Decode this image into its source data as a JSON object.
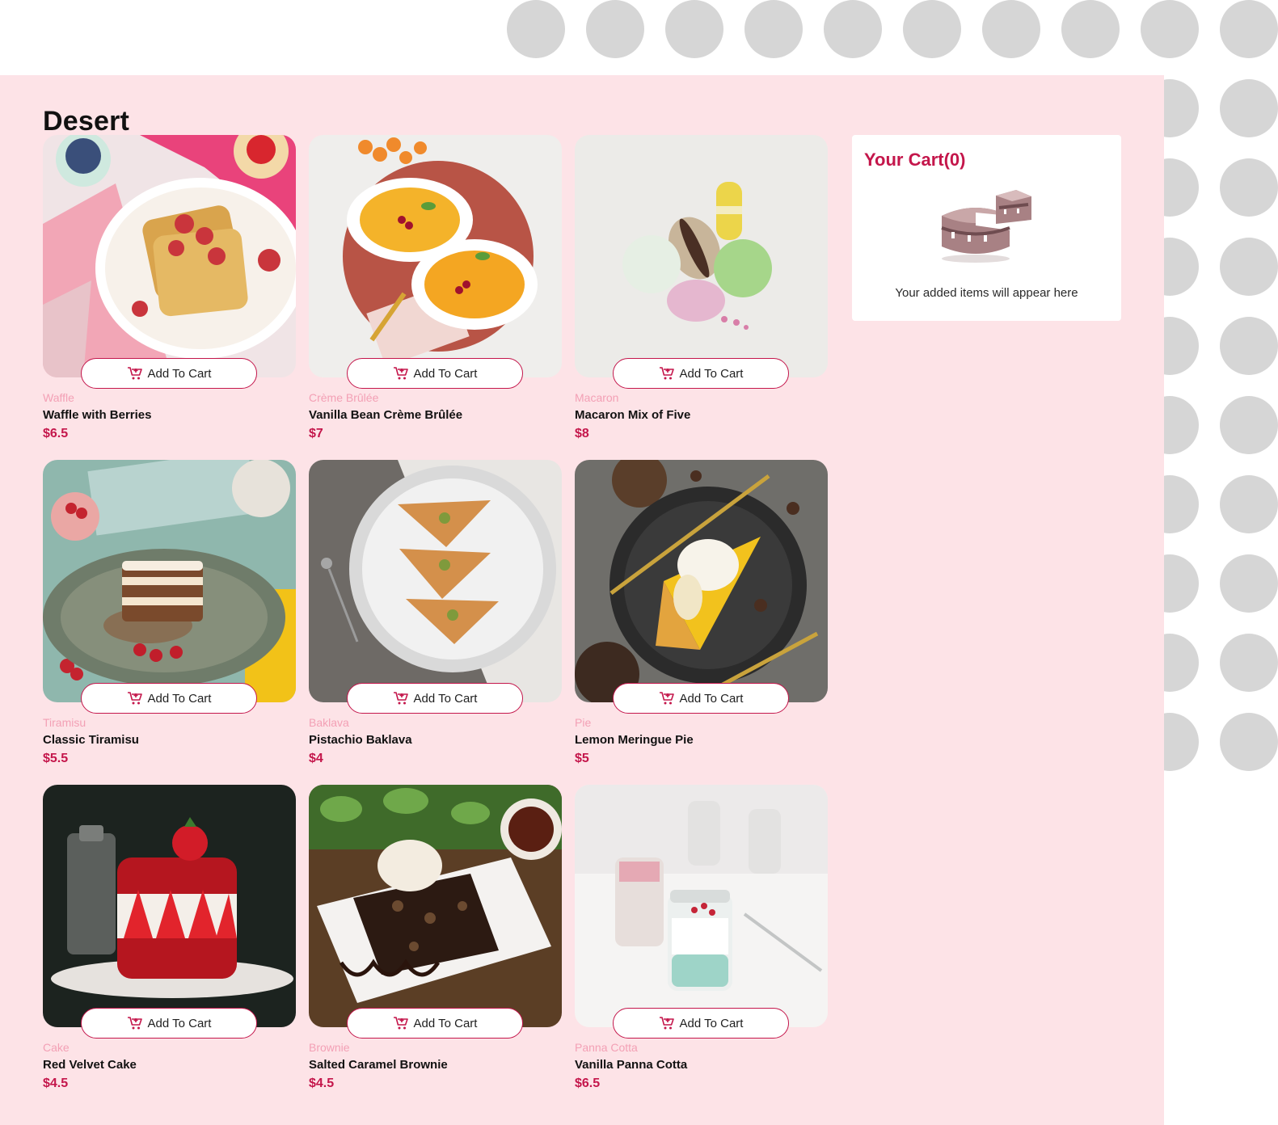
{
  "section": {
    "title": "Desert"
  },
  "products": [
    {
      "category": "Waffle",
      "name": "Waffle with Berries",
      "price": "$6.5",
      "button_label": "Add To Cart",
      "image": "waffle-image"
    },
    {
      "category": "Crème Brûlée",
      "name": "Vanilla Bean Crème Brûlée",
      "price": "$7",
      "button_label": "Add To Cart",
      "image": "creme-brulee-image"
    },
    {
      "category": "Macaron",
      "name": "Macaron Mix of Five",
      "price": "$8",
      "button_label": "Add To Cart",
      "image": "macaron-image"
    },
    {
      "category": "Tiramisu",
      "name": "Classic Tiramisu",
      "price": "$5.5",
      "button_label": "Add To Cart",
      "image": "tiramisu-image"
    },
    {
      "category": "Baklava",
      "name": "Pistachio Baklava",
      "price": "$4",
      "button_label": "Add To Cart",
      "image": "baklava-image"
    },
    {
      "category": "Pie",
      "name": "Lemon Meringue Pie",
      "price": "$5",
      "button_label": "Add To Cart",
      "image": "pie-image"
    },
    {
      "category": "Cake",
      "name": "Red Velvet Cake",
      "price": "$4.5",
      "button_label": "Add To Cart",
      "image": "cake-image"
    },
    {
      "category": "Brownie",
      "name": "Salted Caramel Brownie",
      "price": "$4.5",
      "button_label": "Add To Cart",
      "image": "brownie-image"
    },
    {
      "category": "Panna Cotta",
      "name": "Vanilla Panna Cotta",
      "price": "$6.5",
      "button_label": "Add To Cart",
      "image": "panna-cotta-image"
    }
  ],
  "cart": {
    "title": "Your Cart(0)",
    "empty_message": "Your added items will appear here",
    "illustration": "empty-cart-cake-icon"
  },
  "colors": {
    "accent": "#c4164b",
    "category_text": "#f3a0b5",
    "panel_bg": "#fde3e7",
    "decor_dots": "#d6d6d6"
  },
  "icons": {
    "add_to_cart": "add-to-cart-icon"
  }
}
